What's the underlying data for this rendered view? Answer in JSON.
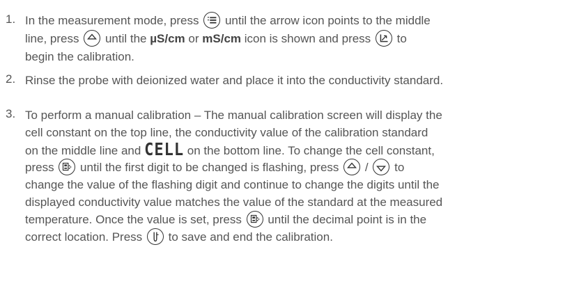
{
  "steps": [
    {
      "number": "1.",
      "lines": {
        "l1a": "In the measurement mode, press",
        "l1b": "until the arrow icon points to the middle",
        "l2a": "line, press",
        "l2b": "until the",
        "l2c": "µS/cm",
        "l2d": "or",
        "l2e": "mS/cm",
        "l2f": "icon is shown and press",
        "l2g": "to",
        "l3": "begin the calibration."
      }
    },
    {
      "number": "2.",
      "lines": {
        "l1": "Rinse the probe with deionized water and place it into the conductivity standard."
      }
    },
    {
      "number": "3.",
      "lines": {
        "l1": "To perform a manual calibration – The manual calibration screen will display the",
        "l2": "cell constant on the top line, the conductivity value of the calibration standard",
        "l3a": "on the middle line and",
        "l3b": "CELL",
        "l3c": "on the bottom line. To change the cell constant,",
        "l4a": "press",
        "l4b": "until the first digit to be changed is flashing, press",
        "l4c": "/",
        "l4d": "to",
        "l5": "change the value of the flashing digit and continue to change the digits until the",
        "l6": "displayed conductivity value matches the value of the standard at the measured",
        "l7a": "temperature.  Once the value is set, press",
        "l7b": "until the decimal point is in the",
        "l8a": "correct location.  Press",
        "l8b": "to save and end the calibration."
      }
    }
  ],
  "icons": [
    "mode-menu-icon",
    "up-arrow-icon",
    "calibrate-icon",
    "digit-select-icon",
    "down-arrow-icon",
    "probe-enter-icon"
  ]
}
